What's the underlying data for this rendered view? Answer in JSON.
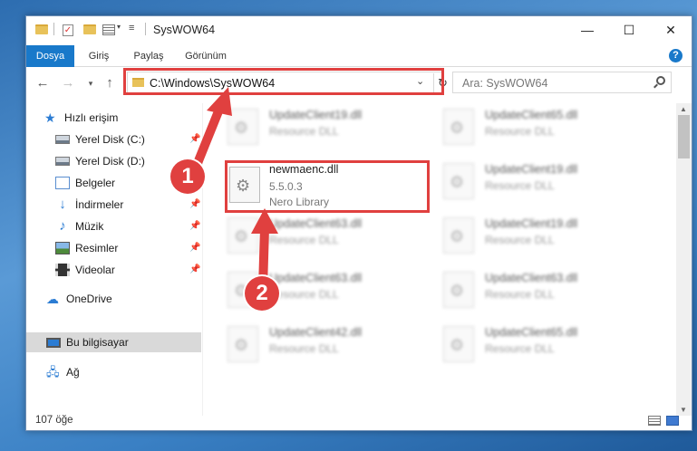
{
  "window": {
    "title": "SysWOW64"
  },
  "ribbon": {
    "tabs": [
      "Dosya",
      "Giriş",
      "Paylaş",
      "Görünüm"
    ],
    "help": "?"
  },
  "address": {
    "path": "C:\\Windows\\SysWOW64",
    "search_placeholder": "Ara: SysWOW64"
  },
  "sidebar": {
    "items": [
      {
        "label": "Hızlı erişim",
        "icon": "star-icon"
      },
      {
        "label": "Yerel Disk (C:)",
        "icon": "disk-icon"
      },
      {
        "label": "Yerel Disk (D:)",
        "icon": "disk-icon"
      },
      {
        "label": "Belgeler",
        "icon": "documents-icon"
      },
      {
        "label": "İndirmeler",
        "icon": "download-icon"
      },
      {
        "label": "Müzik",
        "icon": "music-icon"
      },
      {
        "label": "Resimler",
        "icon": "pictures-icon"
      },
      {
        "label": "Videolar",
        "icon": "videos-icon"
      },
      {
        "label": "OneDrive",
        "icon": "cloud-icon"
      },
      {
        "label": "Bu bilgisayar",
        "icon": "computer-icon"
      },
      {
        "label": "Ağ",
        "icon": "network-icon"
      }
    ]
  },
  "files": {
    "focused": {
      "name": "newmaenc.dll",
      "version": "5.5.0.3",
      "description": "Nero Library"
    },
    "blurred": [
      {
        "name": "UpdateClient19.dll",
        "description": "Resource DLL"
      },
      {
        "name": "UpdateClient65.dll",
        "description": "Resource DLL"
      },
      {
        "name": "UpdateClient19.dll",
        "description": "Resource DLL"
      },
      {
        "name": "UpdateClient63.dll",
        "description": "Resource DLL"
      },
      {
        "name": "UpdateClient19.dll",
        "description": "Resource DLL"
      },
      {
        "name": "UpdateClient63.dll",
        "description": "Resource DLL"
      },
      {
        "name": "UpdateClient63.dll",
        "description": "Resource DLL"
      },
      {
        "name": "UpdateClient42.dll",
        "description": "Resource DLL"
      },
      {
        "name": "UpdateClient65.dll",
        "description": "Resource DLL"
      }
    ]
  },
  "status": {
    "count": "107 öğe"
  },
  "annotations": {
    "badge1": "1",
    "badge2": "2",
    "color": "#e0403f"
  }
}
